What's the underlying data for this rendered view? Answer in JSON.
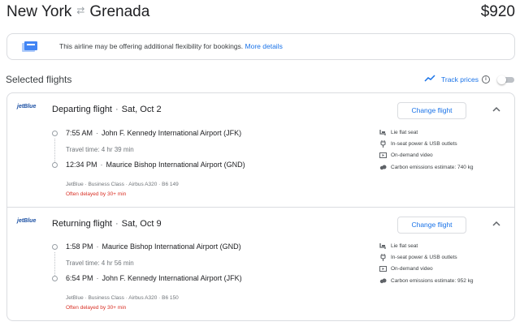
{
  "header": {
    "origin": "New York",
    "destination": "Grenada",
    "price": "$920"
  },
  "notice": {
    "text": "This airline may be offering additional flexibility for bookings.",
    "link": "More details"
  },
  "selected": {
    "title": "Selected flights",
    "track_label": "Track prices",
    "info": "i"
  },
  "segments": [
    {
      "airline_logo": "jetBlue",
      "title": "Departing flight",
      "date": "Sat, Oct 2",
      "change_label": "Change flight",
      "dep_time": "7:55 AM",
      "dep_airport": "John F. Kennedy International Airport (JFK)",
      "duration": "Travel time: 4 hr 39 min",
      "arr_time": "12:34 PM",
      "arr_airport": "Maurice Bishop International Airport (GND)",
      "meta": "JetBlue · Business Class · Airbus A320 · B6 149",
      "delay": "Often delayed by 30+ min",
      "amenities": [
        "Lie flat seat",
        "In-seat power & USB outlets",
        "On-demand video",
        "Carbon emissions estimate: 740 kg"
      ]
    },
    {
      "airline_logo": "jetBlue",
      "title": "Returning flight",
      "date": "Sat, Oct 9",
      "change_label": "Change flight",
      "dep_time": "1:58 PM",
      "dep_airport": "Maurice Bishop International Airport (GND)",
      "duration": "Travel time: 4 hr 56 min",
      "arr_time": "6:54 PM",
      "arr_airport": "John F. Kennedy International Airport (JFK)",
      "meta": "JetBlue · Business Class · Airbus A320 · B6 150",
      "delay": "Often delayed by 30+ min",
      "amenities": [
        "Lie flat seat",
        "In-seat power & USB outlets",
        "On-demand video",
        "Carbon emissions estimate: 952 kg"
      ]
    }
  ],
  "colors": {
    "accent": "#1a73e8",
    "delay": "#d93025",
    "border": "#dadce0"
  },
  "icons": [
    "swap-arrows-icon",
    "flexible-booking-icon",
    "trend-icon",
    "info-icon",
    "chevron-up-icon",
    "seat-icon",
    "power-plug-icon",
    "video-icon",
    "emissions-icon"
  ]
}
